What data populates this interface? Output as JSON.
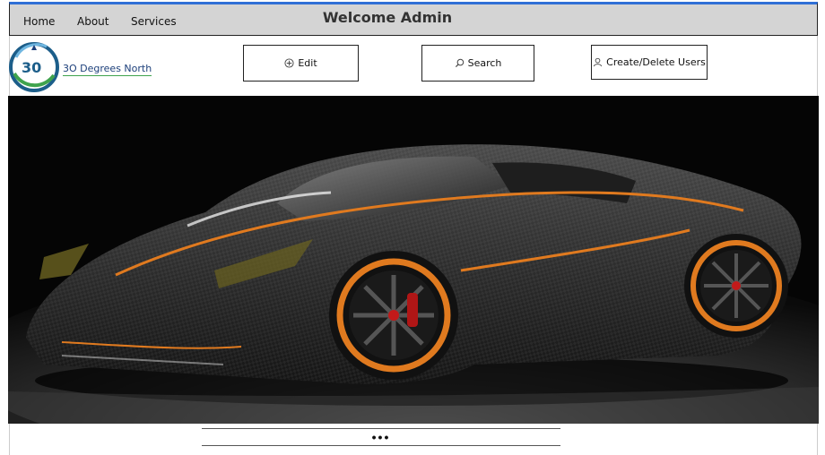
{
  "nav": {
    "home": "Home",
    "about": "About",
    "services": "Services",
    "welcome": "Welcome Admin"
  },
  "logo": {
    "badge": "30",
    "text": "3O Degrees North",
    "icon": "logo-globe-icon"
  },
  "actions": {
    "edit": {
      "label": "Edit",
      "icon": "plus-circle-icon"
    },
    "search": {
      "label": "Search",
      "icon": "search-icon"
    },
    "users": {
      "label": "Create/Delete Users",
      "icon": "user-icon"
    }
  },
  "hero": {
    "image": "black carbon-fiber supercar with orange accents"
  },
  "carousel": {
    "indicator": "•••"
  },
  "colors": {
    "topbar_bg": "#d4d4d4",
    "topbar_accent": "#2f6fd6",
    "car_accent": "#e07a1f"
  }
}
